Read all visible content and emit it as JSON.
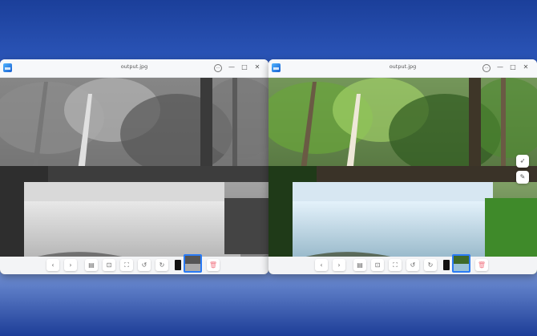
{
  "windows": [
    {
      "id": "left",
      "title": "output.jpg",
      "mode": "grayscale",
      "title_buttons": {
        "more": "···",
        "minimize": "—",
        "maximize": "□",
        "close": "✕"
      },
      "toolbar": {
        "prev": "‹",
        "next": "›",
        "fit_window": "▤",
        "fit_image": "⊡",
        "fullscreen": "⛶",
        "rotate_left": "↺",
        "rotate_right": "↻",
        "delete": "🗑"
      }
    },
    {
      "id": "right",
      "title": "output.jpg",
      "mode": "color",
      "title_buttons": {
        "more": "···",
        "minimize": "—",
        "maximize": "□",
        "close": "✕"
      },
      "toolbar": {
        "prev": "‹",
        "next": "›",
        "fit_window": "▤",
        "fit_image": "⊡",
        "fullscreen": "⛶",
        "rotate_left": "↺",
        "rotate_right": "↻",
        "delete": "🗑"
      },
      "side_tools": {
        "share": "➶",
        "edit": "✎"
      }
    }
  ],
  "colors": {
    "accent": "#2a7bf5",
    "delete": "#f27e8a"
  }
}
